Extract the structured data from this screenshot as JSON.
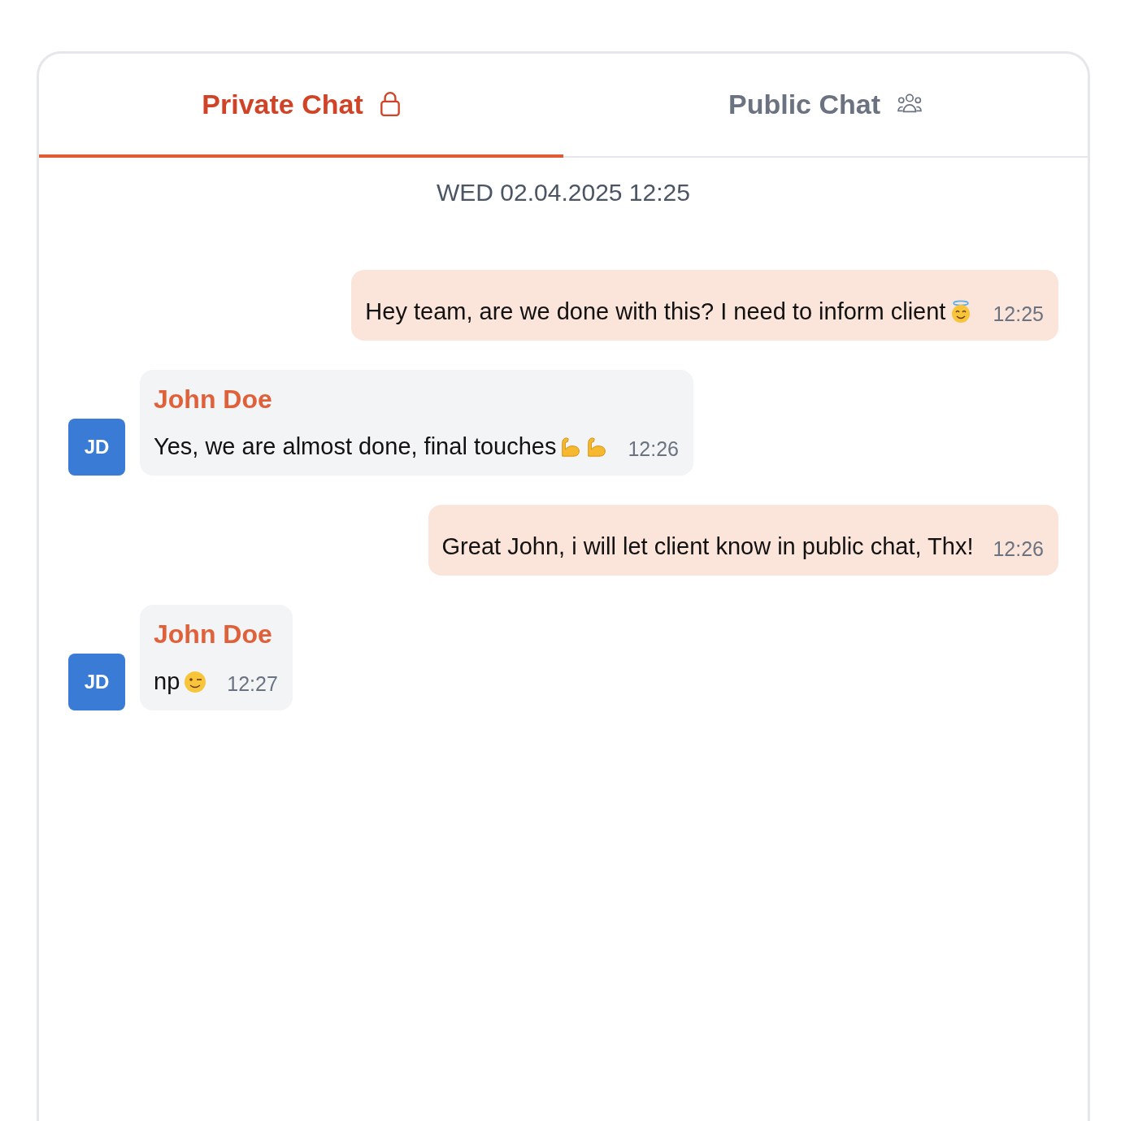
{
  "tabs": [
    {
      "label": "Private Chat",
      "selected": true
    },
    {
      "label": "Public Chat",
      "selected": false
    }
  ],
  "date": "WED 02.04.2025 12:25",
  "messages": [
    {
      "kind": "outgoing",
      "text": "Hey team, are we done with this? I need to inform client",
      "time": "12:25"
    },
    {
      "kind": "incoming",
      "initials": "JD",
      "sender": "John Doe",
      "text": "Yes, we are almost done, final touches",
      "time": "12:26"
    },
    {
      "kind": "outgoing",
      "text": "Great John, i will let client know in public chat, Thx!",
      "time": "12:26"
    },
    {
      "kind": "incoming",
      "initials": "JD",
      "sender": "John Doe",
      "text": "np",
      "time": "12:27"
    }
  ]
}
